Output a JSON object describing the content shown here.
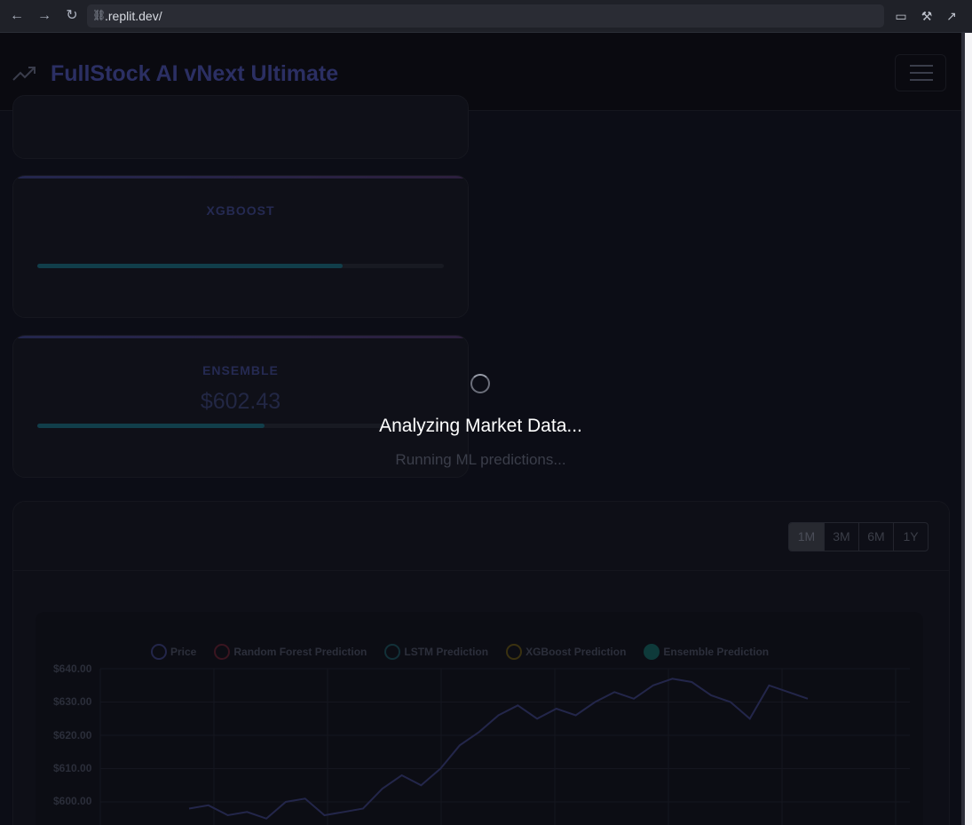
{
  "browser": {
    "url": ".replit.dev/",
    "back_icon": "arrow-left-icon",
    "forward_icon": "arrow-right-icon",
    "reload_icon": "reload-icon"
  },
  "header": {
    "title": "FullStock AI vNext Ultimate",
    "logo_icon": "trending-up-icon",
    "menu_icon": "hamburger-menu-icon"
  },
  "models": [
    {
      "name": "XGBOOST",
      "value": "",
      "confidence": 0.75
    },
    {
      "name": "ENSEMBLE",
      "value": "$602.43",
      "confidence": 0.56
    }
  ],
  "range_buttons": [
    "1M",
    "3M",
    "6M",
    "1Y"
  ],
  "range_selected": "1M",
  "loading": {
    "title": "Analyzing Market Data...",
    "subtitle": "Running ML predictions..."
  },
  "colors": {
    "price": "#23264a",
    "random_forest": "#3a1520",
    "lstm": "#123038",
    "xgboost": "#3a3110",
    "ensemble": "#0e3a3a"
  },
  "chart_data": {
    "type": "line",
    "legend": [
      "Price",
      "Random Forest Prediction",
      "LSTM Prediction",
      "XGBoost Prediction",
      "Ensemble Prediction"
    ],
    "y_ticks": [
      "$640.00",
      "$630.00",
      "$620.00",
      "$610.00",
      "$600.00"
    ],
    "ylim": [
      596,
      640
    ],
    "series": [
      {
        "name": "Price",
        "values": [
          598,
          599,
          596,
          597,
          595,
          600,
          601,
          596,
          597,
          598,
          604,
          608,
          605,
          610,
          617,
          621,
          626,
          629,
          625,
          628,
          626,
          630,
          633,
          631,
          635,
          637,
          636,
          632,
          630,
          625,
          635,
          633,
          631
        ]
      }
    ]
  }
}
